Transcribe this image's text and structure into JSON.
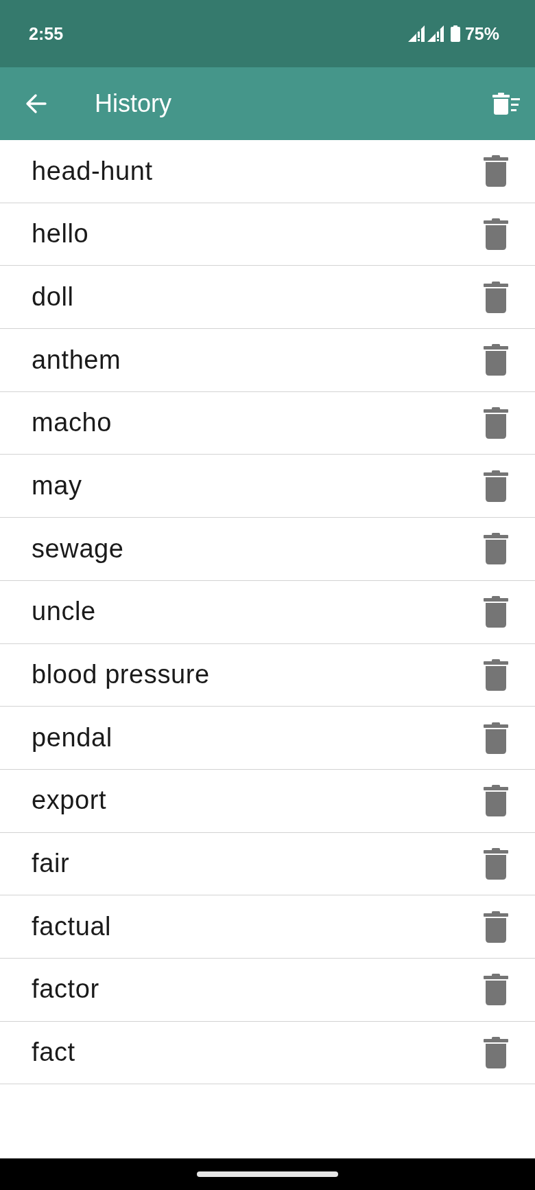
{
  "status_bar": {
    "time": "2:55",
    "battery": "75%"
  },
  "app_bar": {
    "title": "History"
  },
  "history": [
    {
      "word": "head-hunt"
    },
    {
      "word": "hello"
    },
    {
      "word": "doll"
    },
    {
      "word": "anthem"
    },
    {
      "word": "macho"
    },
    {
      "word": "may"
    },
    {
      "word": "sewage"
    },
    {
      "word": "uncle"
    },
    {
      "word": "blood pressure"
    },
    {
      "word": "pendal"
    },
    {
      "word": "export"
    },
    {
      "word": "fair"
    },
    {
      "word": "factual"
    },
    {
      "word": "factor"
    },
    {
      "word": "fact"
    }
  ]
}
